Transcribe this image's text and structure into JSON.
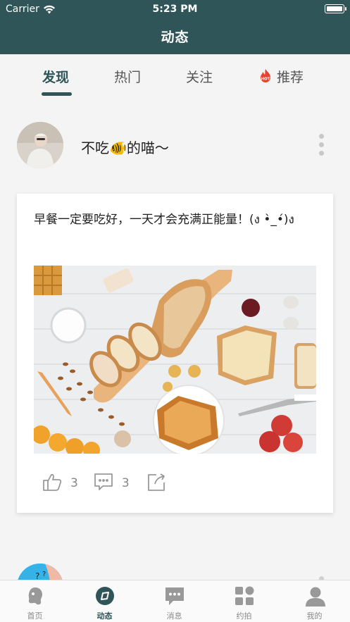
{
  "status_bar": {
    "carrier": "Carrier",
    "time": "5:23 PM"
  },
  "nav": {
    "title": "动态"
  },
  "tabs": [
    {
      "label": "发现",
      "active": true
    },
    {
      "label": "热门",
      "active": false
    },
    {
      "label": "关注",
      "active": false
    },
    {
      "label": "推荐",
      "active": false,
      "icon": "hot-flame-icon"
    }
  ],
  "post": {
    "username": "不吃🐠的喵～",
    "text": "早餐一定要吃好，一天才会充满正能量！(ง •̀_•́)ง",
    "image_alt": "breakfast bread photo",
    "likes": "3",
    "comments": "3"
  },
  "tabbar": [
    {
      "label": "首页",
      "icon": "home-icon",
      "active": false
    },
    {
      "label": "动态",
      "icon": "compass-icon",
      "active": true
    },
    {
      "label": "消息",
      "icon": "message-icon",
      "active": false
    },
    {
      "label": "约拍",
      "icon": "grid-icon",
      "active": false
    },
    {
      "label": "我的",
      "icon": "profile-icon",
      "active": false
    }
  ],
  "colors": {
    "primary": "#2f5558",
    "background": "#f4f4f4",
    "hot": "#e8432e"
  }
}
